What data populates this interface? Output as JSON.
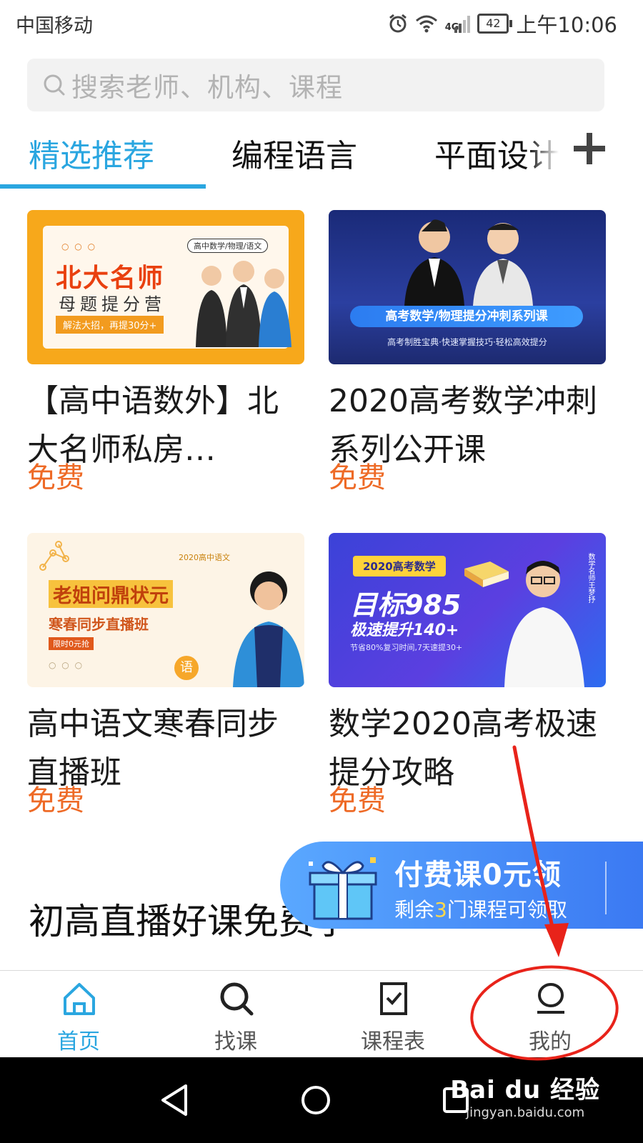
{
  "status_bar": {
    "carrier": "中国移动",
    "network": "4G",
    "battery": "42",
    "time": "上午10:06"
  },
  "search": {
    "placeholder": "搜索老师、机构、课程"
  },
  "tabs": [
    {
      "label": "精选推荐",
      "active": true
    },
    {
      "label": "编程语言",
      "active": false
    },
    {
      "label": "平面设计",
      "active": false
    }
  ],
  "courses": [
    {
      "title": "【高中语数外】北大名师私房…",
      "price": "免费",
      "thumb": {
        "tag": "高中数学/物理/语文",
        "headline": "北大名师",
        "subline": "母题提分营",
        "note": "解法大招，再提30分+"
      }
    },
    {
      "title": "2020高考数学冲刺系列公开课",
      "price": "免费",
      "thumb": {
        "headline": "高考数学/物理提分冲刺系列课",
        "subline": "高考制胜宝典·快速掌握技巧·轻松高效提分"
      }
    },
    {
      "title": "高中语文寒春同步直播班",
      "price": "免费",
      "thumb": {
        "tag": "2020高中语文",
        "headline": "老姐问鼎状元",
        "subline": "寒春同步直播班",
        "note": "限时0元抢",
        "seal": "语"
      }
    },
    {
      "title": "数学2020高考极速提分攻略",
      "price": "免费",
      "thumb": {
        "tag": "2020高考数学",
        "headline": "目标985",
        "subline": "极速提升140+",
        "note": "节省80%复习时间,7天速提30+",
        "side": "数学名师王梦抒"
      }
    }
  ],
  "section": {
    "title": "初高直播好课免费学"
  },
  "promo": {
    "title": "付费课0元领",
    "sub_prefix": "剩余",
    "sub_count": "3",
    "sub_suffix": "门课程可领取"
  },
  "bottom_nav": [
    {
      "label": "首页",
      "icon": "home-icon",
      "active": true
    },
    {
      "label": "找课",
      "icon": "search-icon",
      "active": false
    },
    {
      "label": "课程表",
      "icon": "schedule-icon",
      "active": false
    },
    {
      "label": "我的",
      "icon": "profile-icon",
      "active": false
    }
  ],
  "watermark": {
    "logo": "Bai du 经验",
    "url": "jingyan.baidu.com"
  },
  "colors": {
    "accent": "#2aa6e0",
    "price": "#ee6a26",
    "annotation": "#e8231a"
  }
}
